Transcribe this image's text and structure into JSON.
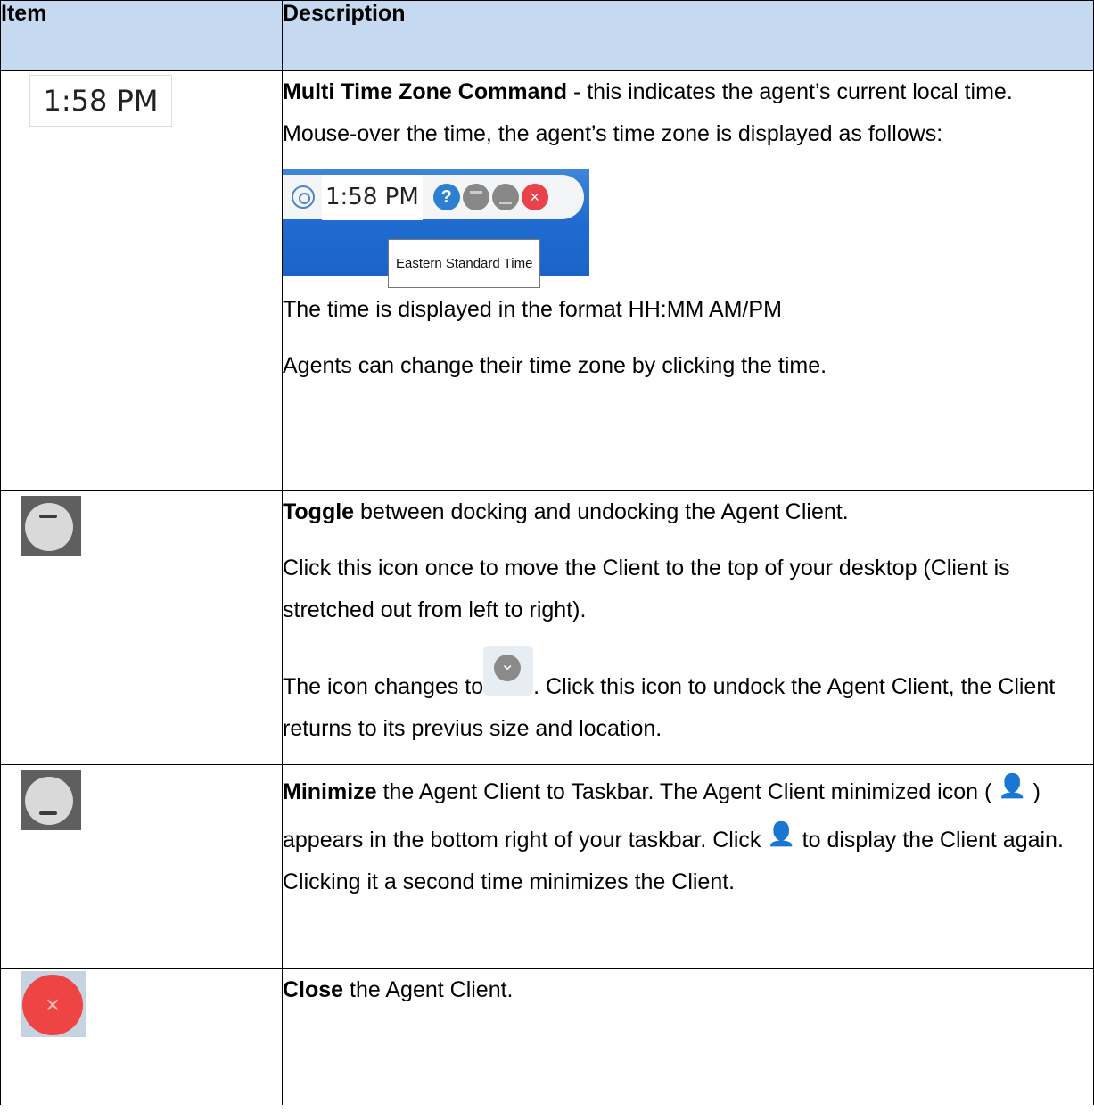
{
  "table": {
    "header": {
      "item": "Item",
      "description": "Description"
    },
    "rows": {
      "time": {
        "item_clock": "1:58 PM",
        "title": "Multi Time Zone Command",
        "text": " - this indicates the agent’s current local time. Mouse-over the time, the agent’s time zone is displayed as follows:",
        "screenshot": {
          "time": "1:58 PM",
          "help": "?",
          "close": "×",
          "tooltip": "Eastern Standard Time"
        },
        "para2": "The time is displayed in the format HH:MM AM/PM",
        "para3": "Agents can change their time zone by clicking the time."
      },
      "toggle": {
        "title": "Toggle",
        "text": " between docking and undocking the Agent Client.",
        "para2": "Click this icon once to move the Client to the top of your desktop (Client is stretched out from left to right).",
        "para3_a": "The icon changes to",
        "para3_b": ". Click this icon to undock the Agent Client, the Client returns to its previus size and location."
      },
      "minimize": {
        "title": "Minimize",
        "text_a": " the Agent Client to Taskbar. The Agent Client minimized icon (",
        "text_b": ") appears in the bottom right of your taskbar. Click",
        "text_c": " to display the Client again. Clicking it a second time minimizes the Client."
      },
      "close": {
        "title": "Close",
        "text": " the Agent Client.",
        "icon": "×"
      }
    }
  },
  "icons": {
    "user_glyph": "👤"
  }
}
